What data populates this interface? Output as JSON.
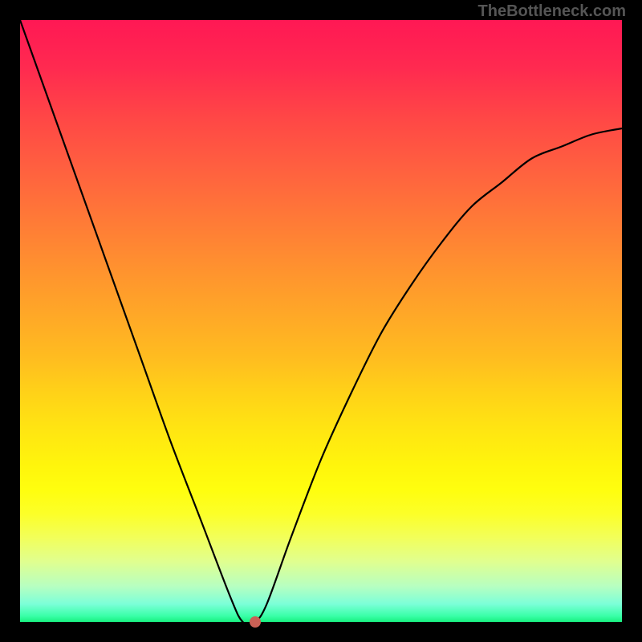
{
  "watermark": "TheBottleneck.com",
  "chart_data": {
    "type": "line",
    "x": [
      0.0,
      0.05,
      0.1,
      0.15,
      0.2,
      0.25,
      0.3,
      0.35,
      0.37,
      0.39,
      0.41,
      0.45,
      0.5,
      0.55,
      0.6,
      0.65,
      0.7,
      0.75,
      0.8,
      0.85,
      0.9,
      0.95,
      1.0
    ],
    "values": [
      1.0,
      0.86,
      0.72,
      0.58,
      0.44,
      0.3,
      0.17,
      0.04,
      0.0,
      0.0,
      0.03,
      0.14,
      0.27,
      0.38,
      0.48,
      0.56,
      0.63,
      0.69,
      0.73,
      0.77,
      0.79,
      0.81,
      0.82
    ],
    "title": "",
    "xlabel": "",
    "ylabel": "",
    "xlim": [
      0,
      1
    ],
    "ylim": [
      0,
      1
    ],
    "marker_point": {
      "x": 0.39,
      "y": 0.0
    },
    "gradient_colors": {
      "top": "#ff1854",
      "mid": "#fff50c",
      "bottom": "#18f080"
    },
    "curve_color": "#000000",
    "marker_color": "#c96055"
  }
}
